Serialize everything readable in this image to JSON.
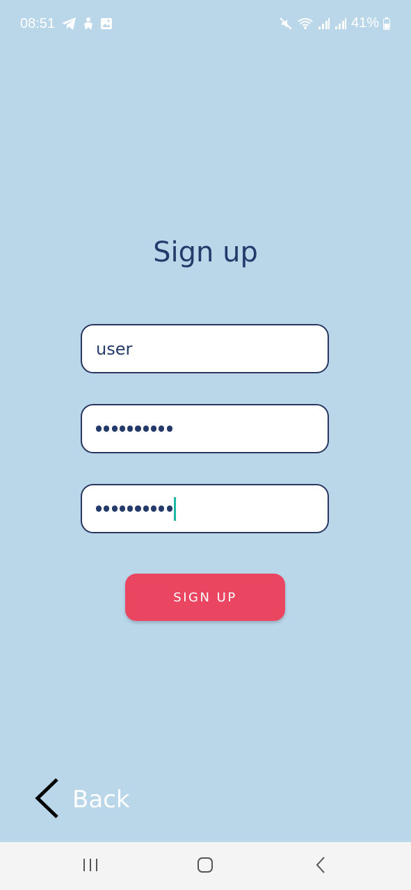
{
  "status_bar": {
    "time": "08:51",
    "battery_percent": "41%",
    "icons_left": [
      "telegram-icon",
      "accessibility-icon",
      "gallery-icon"
    ],
    "icons_right": [
      "mute-icon",
      "wifi-icon",
      "signal-icon",
      "signal-icon",
      "battery-icon"
    ]
  },
  "page": {
    "title": "Sign up"
  },
  "form": {
    "username_value": "user",
    "password_masked_length": 10,
    "confirm_password_masked_length": 10,
    "submit_label": "SIGN UP"
  },
  "back": {
    "label": "Back",
    "icon": "chevron-left-icon"
  },
  "navigation_bar": {
    "buttons": [
      "recents-icon",
      "home-icon",
      "back-icon"
    ]
  },
  "colors": {
    "background": "#bad7ea",
    "title": "#243a6b",
    "field_border": "#29365f",
    "button": "#ea4561",
    "caret": "#1bb5a6",
    "nav_bar": "#f4f4f4"
  }
}
